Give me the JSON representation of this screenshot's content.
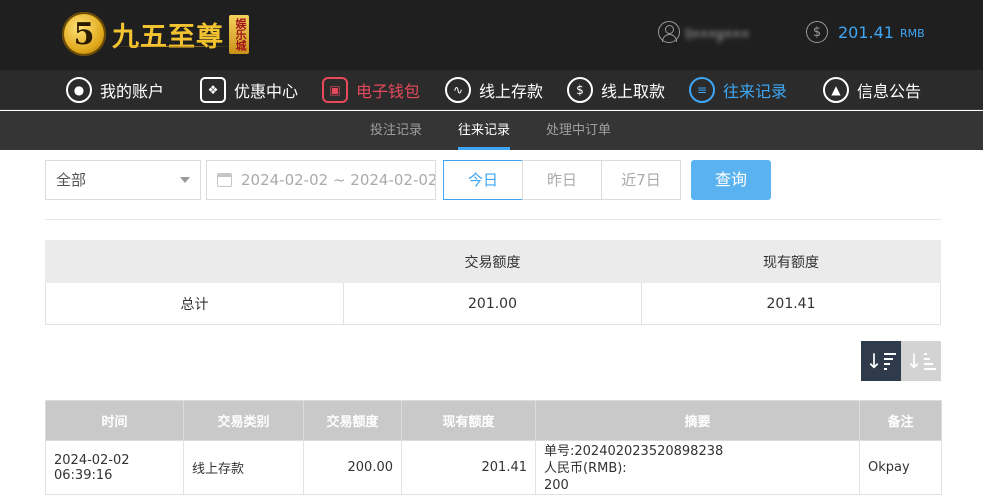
{
  "brand": {
    "logo_digit": "5",
    "name": "九五至尊",
    "sub": "娱乐城"
  },
  "user": {
    "name": "t•••y•••"
  },
  "balance": {
    "amount": "201.41",
    "currency": "RMB"
  },
  "nav": [
    {
      "label": "我的账户",
      "icon": "user-icon"
    },
    {
      "label": "优惠中心",
      "icon": "gift-icon"
    },
    {
      "label": "电子钱包",
      "icon": "wallet-icon"
    },
    {
      "label": "线上存款",
      "icon": "deposit-icon"
    },
    {
      "label": "线上取款",
      "icon": "withdraw-icon"
    },
    {
      "label": "往来记录",
      "icon": "records-icon"
    },
    {
      "label": "信息公告",
      "icon": "bell-icon"
    }
  ],
  "subnav": [
    {
      "label": "投注记录"
    },
    {
      "label": "往来记录"
    },
    {
      "label": "处理中订单"
    }
  ],
  "filter": {
    "type_selected": "全部",
    "date_range": "2024-02-02 ~ 2024-02-02",
    "quick": [
      "今日",
      "昨日",
      "近7日"
    ],
    "query_label": "查询"
  },
  "summary": {
    "headers": [
      "",
      "交易额度",
      "现有额度"
    ],
    "row": [
      "总计",
      "201.00",
      "201.41"
    ]
  },
  "records": {
    "headers": [
      "时间",
      "交易类别",
      "交易额度",
      "现有额度",
      "摘要",
      "备注"
    ],
    "rows": [
      {
        "time": "2024-02-02 06:39:16",
        "type": "线上存款",
        "amount": "200.00",
        "balance": "201.41",
        "summary_line1": "单号:202402023520898238",
        "summary_line2": "人民币(RMB):",
        "summary_line3": "200",
        "note": "Okpay"
      }
    ]
  },
  "colors": {
    "accent": "#3ea6f5",
    "wallet": "#e8495c",
    "gold": "#f2c230",
    "header_bg": "#1f1f1f"
  }
}
